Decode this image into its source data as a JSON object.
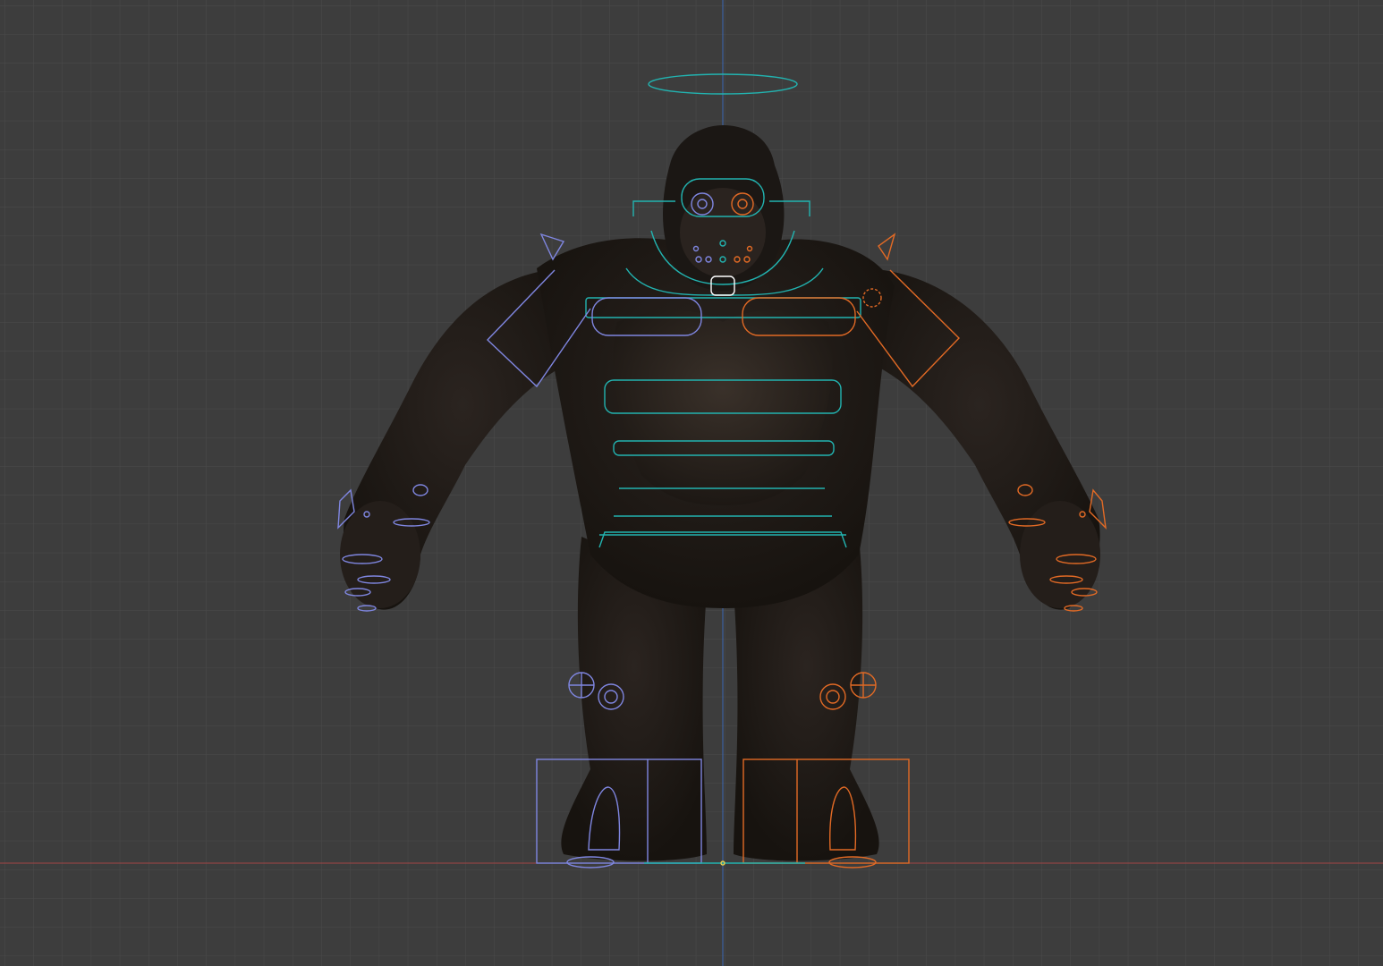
{
  "viewport": {
    "view": "front-orthographic",
    "background_color": "#3d3d3d",
    "grid_minor_color": "#474747",
    "grid_major_color": "#4d4d4d",
    "axis_x_color": "#b04848",
    "axis_z_color": "#3f6fbf"
  },
  "rig": {
    "center_color": "#22b3b0",
    "left_color": "#7f86e0",
    "right_color": "#e26a25",
    "fur_color": "#1f1a17"
  }
}
